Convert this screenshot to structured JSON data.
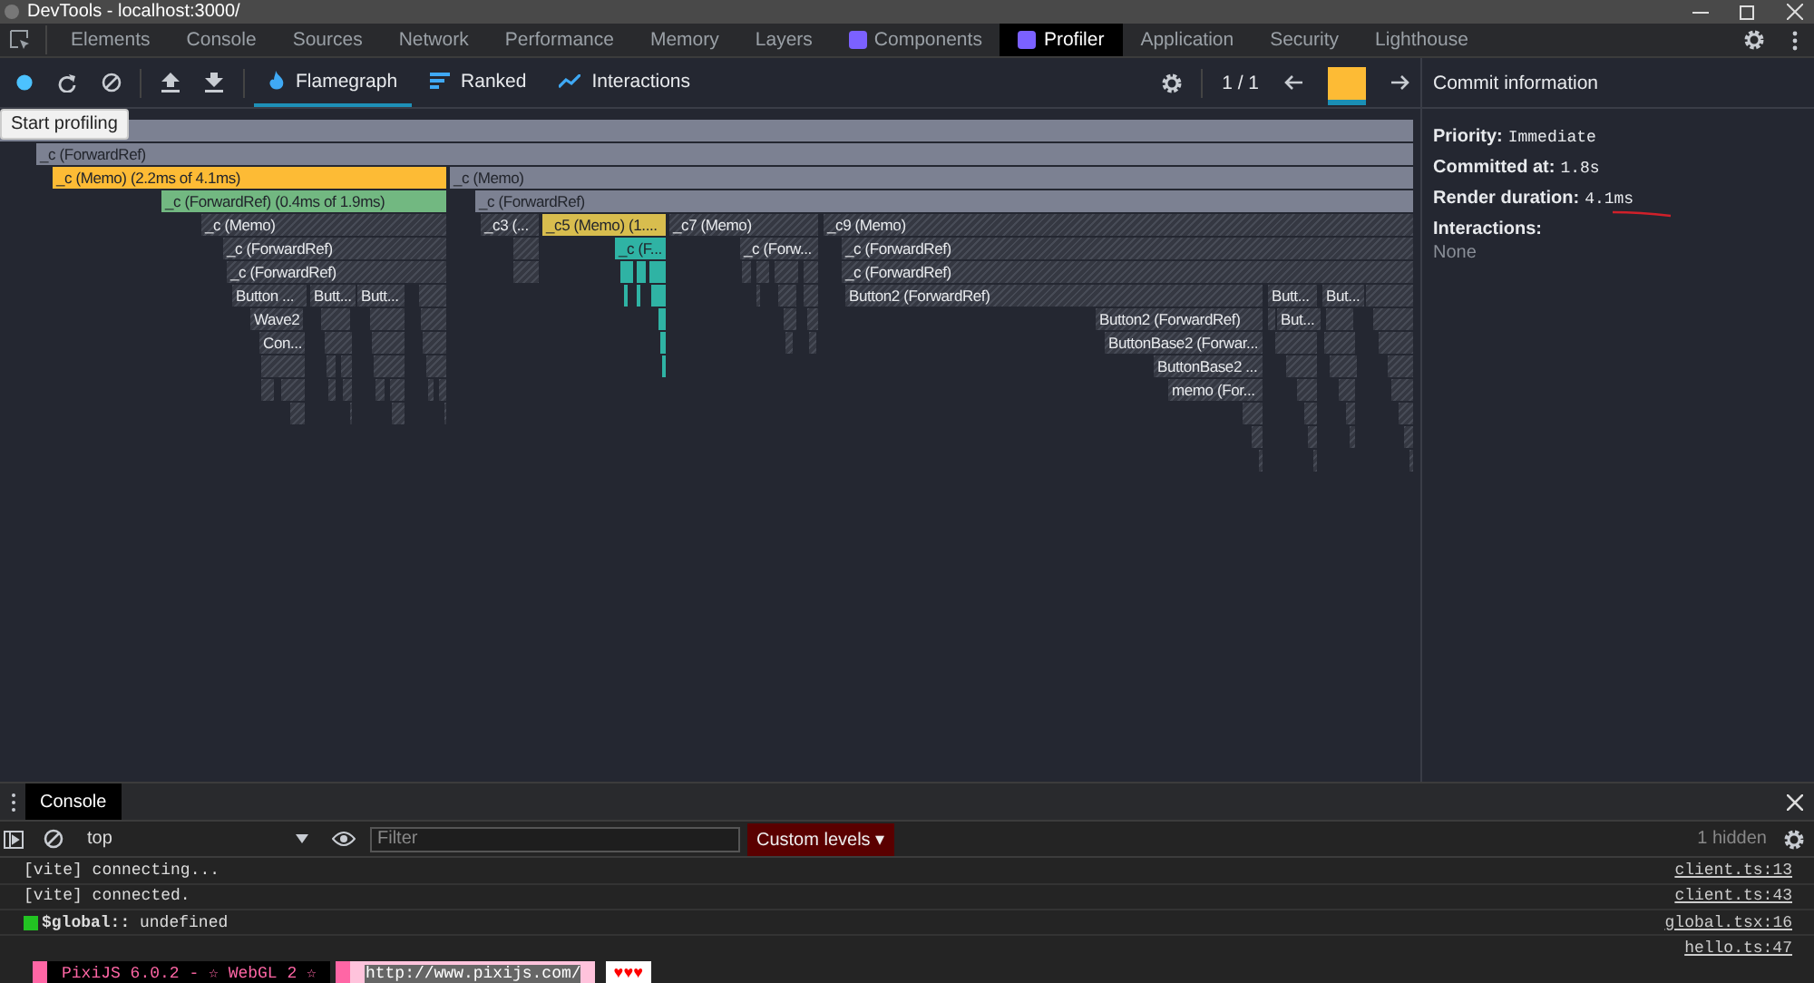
{
  "window": {
    "title": "DevTools - localhost:3000/"
  },
  "tabs": [
    {
      "label": "Elements",
      "kind": "plain",
      "selected": false
    },
    {
      "label": "Console",
      "kind": "plain",
      "selected": false
    },
    {
      "label": "Sources",
      "kind": "plain",
      "selected": false
    },
    {
      "label": "Network",
      "kind": "plain",
      "selected": false
    },
    {
      "label": "Performance",
      "kind": "plain",
      "selected": false
    },
    {
      "label": "Memory",
      "kind": "plain",
      "selected": false
    },
    {
      "label": "Layers",
      "kind": "plain",
      "selected": false
    },
    {
      "label": "Components",
      "kind": "react",
      "selected": false
    },
    {
      "label": "Profiler",
      "kind": "react",
      "selected": true
    },
    {
      "label": "Application",
      "kind": "plain",
      "selected": false
    },
    {
      "label": "Security",
      "kind": "plain",
      "selected": false
    },
    {
      "label": "Lighthouse",
      "kind": "plain",
      "selected": false
    }
  ],
  "profiler": {
    "modes": [
      {
        "label": "Flamegraph",
        "kind": "flame",
        "selected": true
      },
      {
        "label": "Ranked",
        "kind": "ranked",
        "selected": false
      },
      {
        "label": "Interactions",
        "kind": "interactions",
        "selected": false
      }
    ],
    "commit_counter": "1 / 1",
    "commits": [
      {
        "selected": true
      }
    ],
    "tooltip": "Start profiling"
  },
  "flamegraph": {
    "levels": [
      {
        "bars": [
          {
            "kind": "gray"
          }
        ]
      },
      {
        "bars": [
          {
            "label": "_c (ForwardRef)",
            "kind": "gray"
          }
        ]
      },
      {
        "bars": [
          {
            "label": "_c (Memo) (2.2ms of 4.1ms)",
            "kind": "yellow"
          },
          {
            "label": "_c (Memo)",
            "kind": "gray"
          }
        ]
      },
      {
        "bars": [
          {
            "label": "_c (ForwardRef) (0.4ms of 1.9ms)",
            "kind": "green"
          },
          {
            "label": "_c (ForwardRef)",
            "kind": "gray"
          }
        ]
      },
      {
        "bars": [
          {
            "label": "_c (Memo)",
            "kind": "hatched"
          },
          {
            "label": "_c3 (...",
            "kind": "hatched"
          },
          {
            "label": "_c5 (Memo) (1....",
            "kind": "gold"
          },
          {
            "label": "_c7 (Memo)",
            "kind": "hatched"
          },
          {
            "label": "_c9 (Memo)",
            "kind": "hatched"
          }
        ]
      },
      {
        "bars": [
          {
            "label": "_c (ForwardRef)",
            "kind": "hatched"
          },
          {
            "label": "_c (F...",
            "kind": "teal"
          },
          {
            "label": "_c (Forw...",
            "kind": "hatched"
          },
          {
            "label": "_c (ForwardRef)",
            "kind": "hatched"
          }
        ]
      },
      {
        "bars": [
          {
            "label": "_c (ForwardRef)",
            "kind": "hatched"
          },
          {
            "label": "_c (ForwardRef)",
            "kind": "hatched"
          }
        ]
      },
      {
        "bars": [
          {
            "label": "Button ...",
            "kind": "hatched"
          },
          {
            "label": "Butt...",
            "kind": "hatched"
          },
          {
            "label": "Butt...",
            "kind": "hatched"
          },
          {
            "label": "Button2 (ForwardRef)",
            "kind": "hatched"
          },
          {
            "label": "Butt...",
            "kind": "hatched"
          },
          {
            "label": "But...",
            "kind": "hatched"
          }
        ]
      },
      {
        "bars": [
          {
            "label": "Wave2",
            "kind": "hatched"
          },
          {
            "label": "Button2 (ForwardRef)",
            "kind": "hatched"
          },
          {
            "label": "But...",
            "kind": "hatched"
          }
        ]
      },
      {
        "bars": [
          {
            "label": "Con...",
            "kind": "hatched"
          },
          {
            "label": "ButtonBase2 (Forwar...",
            "kind": "hatched"
          }
        ]
      },
      {
        "bars": [
          {
            "label": "ButtonBase2 ...",
            "kind": "hatched"
          }
        ]
      },
      {
        "bars": [
          {
            "label": "memo (For...",
            "kind": "hatched"
          }
        ]
      }
    ]
  },
  "commit_info": {
    "title": "Commit information",
    "fields": [
      {
        "label": "Priority:",
        "value": "Immediate"
      },
      {
        "label": "Committed at:",
        "value": "1.8s"
      },
      {
        "label": "Render duration:",
        "value": "4.1ms"
      }
    ],
    "interactions_label": "Interactions:",
    "interactions_value": "None"
  },
  "console": {
    "tab": "Console",
    "context": "top",
    "filter_placeholder": "Filter",
    "levels": "Custom levels",
    "levels_caret": "▾",
    "hidden": "1 hidden",
    "messages": [
      {
        "kind": "text",
        "text": "[vite] connecting...",
        "source": "client.ts:13"
      },
      {
        "kind": "text",
        "text": "[vite] connected.",
        "source": "client.ts:43"
      },
      {
        "kind": "badge",
        "text": "**$global::** undefined",
        "source": "global.tsx:16"
      },
      {
        "kind": "source",
        "source": "hello.ts:47"
      },
      {
        "kind": "banner",
        "segments": [
          "PixiJS 6.0.2 - ☆ WebGL 2 ☆",
          "http://www.pixijs.com/",
          "♥♥♥"
        ]
      }
    ]
  }
}
